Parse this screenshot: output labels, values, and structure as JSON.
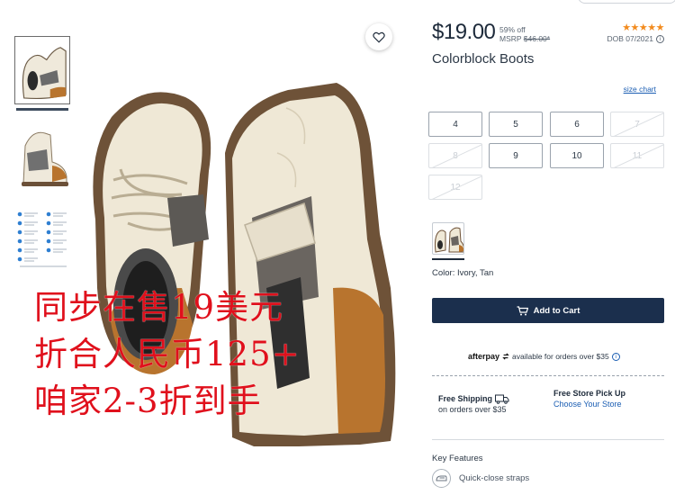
{
  "product": {
    "price": "$19.00",
    "discount": "59% off",
    "msrp_label": "MSRP",
    "msrp_value": "$46.00*",
    "rating_stars": "★★★★★",
    "rating_value": 5,
    "dob": "DOB 07/2021",
    "title": "Colorblock Boots",
    "size_chart_label": "size chart",
    "sizes": [
      {
        "label": "4",
        "available": true
      },
      {
        "label": "5",
        "available": true
      },
      {
        "label": "6",
        "available": true
      },
      {
        "label": "7",
        "available": false
      },
      {
        "label": "8",
        "available": false
      },
      {
        "label": "9",
        "available": true
      },
      {
        "label": "10",
        "available": true
      },
      {
        "label": "11",
        "available": false
      },
      {
        "label": "12",
        "available": false
      }
    ],
    "color_label": "Color: Ivory, Tan",
    "add_to_cart_label": "Add to Cart",
    "afterpay_brand": "afterpay",
    "afterpay_text": "available for orders over $35",
    "free_shipping_title": "Free Shipping",
    "free_shipping_sub": "on orders over $35",
    "pickup_title": "Free Store Pick Up",
    "pickup_link": "Choose Your Store",
    "key_features_title": "Key Features",
    "key_features": [
      "Quick-close straps"
    ]
  },
  "overlay": {
    "line1": "同步在售19美元",
    "line2": "折合人民币125+",
    "line3": "咱家2-3折到手"
  },
  "icons": {
    "favorite": "heart-icon",
    "cart": "cart-icon",
    "info": "info-icon",
    "truck": "truck-icon",
    "feature": "strap-icon"
  },
  "colors": {
    "primary_button": "#1b2f4d",
    "link": "#1b5eb3",
    "stars": "#f28b1e",
    "overlay_text": "#e0101c"
  }
}
